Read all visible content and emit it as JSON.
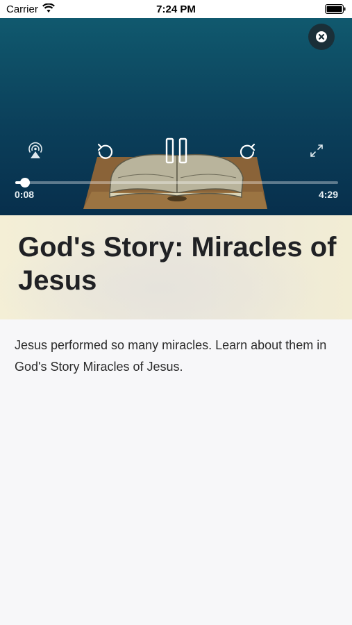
{
  "status_bar": {
    "carrier": "Carrier",
    "time": "7:24 PM"
  },
  "player": {
    "elapsed": "0:08",
    "total": "4:29",
    "progress_fraction": 0.03,
    "accent": "#ffffff",
    "icons": [
      "close-icon",
      "airplay-icon",
      "rewind-icon",
      "pause-icon",
      "forward-icon",
      "fullscreen-icon"
    ]
  },
  "content": {
    "title": "God's Story: Miracles of Jesus",
    "description": "Jesus performed so many miracles. Learn about them in God's Story Miracles of Jesus."
  }
}
